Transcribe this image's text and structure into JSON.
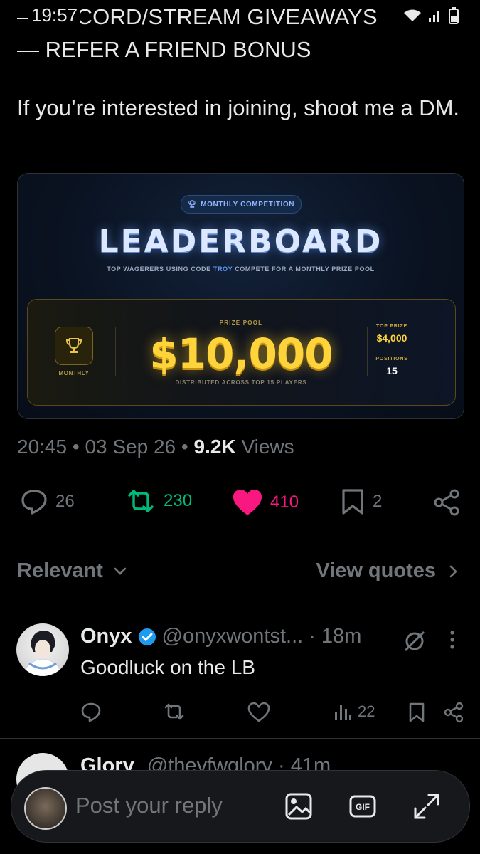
{
  "status_bar": {
    "time": "19:57"
  },
  "tweet": {
    "line1": "—DISCORD/STREAM GIVEAWAYS",
    "line2": "— REFER A FRIEND BONUS",
    "body": "If you’re interested in joining, shoot me a DM."
  },
  "card": {
    "badge": "MONTHLY COMPETITION",
    "title": "LEADERBOARD",
    "subtitle_pre": "TOP WAGERERS USING CODE",
    "subtitle_code": "TROY",
    "subtitle_post": "COMPETE FOR A MONTHLY PRIZE POOL",
    "monthly_label": "MONTHLY",
    "prize_pool_label": "PRIZE POOL",
    "prize_amount": "$10,000",
    "distributed": "DISTRIBUTED ACROSS TOP 15 PLAYERS",
    "top_prize_label": "TOP PRIZE",
    "top_prize_value": "$4,000",
    "positions_label": "POSITIONS",
    "positions_value": "15",
    "colors": {
      "gold": "#ffd43a",
      "blue": "#5f9cff"
    }
  },
  "meta": {
    "time": "20:45",
    "date": "03 Sep 26",
    "views_count": "9.2K",
    "views_label": "Views"
  },
  "actions": {
    "replies": "26",
    "reposts": "230",
    "likes": "410",
    "bookmarks": "2"
  },
  "colors": {
    "repost": "#00ba7c",
    "like": "#f91880",
    "muted": "#71767b",
    "verified": "#1d9bf0"
  },
  "sort": {
    "label": "Relevant",
    "view_quotes": "View quotes"
  },
  "reply1": {
    "name": "Onyx",
    "handle": "@onyxwontst...",
    "time": "· 18m",
    "text": "Goodluck on the LB",
    "views": "22"
  },
  "reply2": {
    "name": "Glory",
    "handle": "@thevfwglory",
    "time": "· 41m"
  },
  "compose": {
    "placeholder": "Post your reply"
  }
}
